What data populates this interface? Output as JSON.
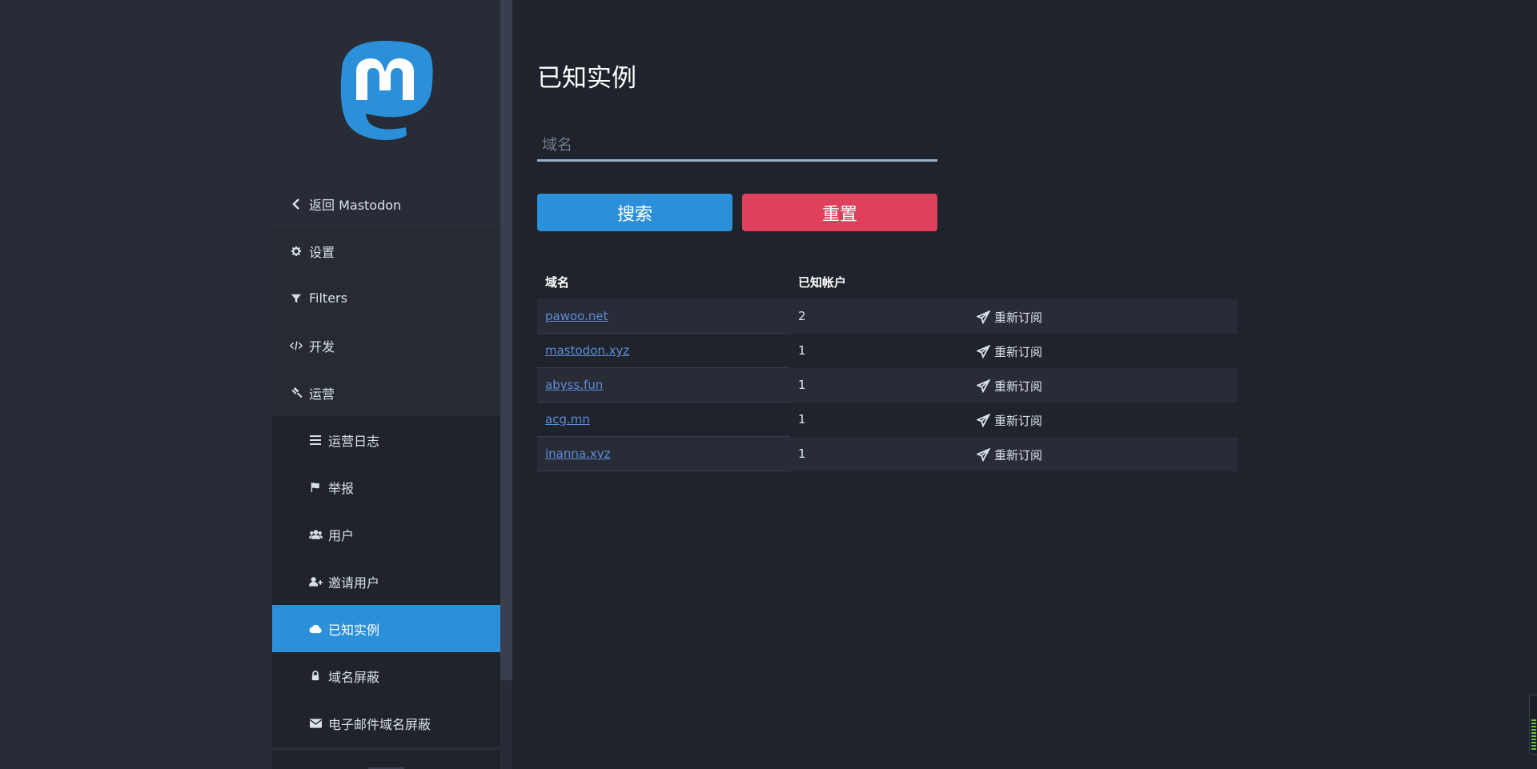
{
  "sidebar": {
    "back": "返回 Mastodon",
    "items": [
      {
        "label": "设置",
        "icon": "gear-icon"
      },
      {
        "label": "Filters",
        "icon": "filter-icon"
      },
      {
        "label": "开发",
        "icon": "code-icon"
      },
      {
        "label": "运营",
        "icon": "gavel-icon"
      }
    ],
    "sub_items": [
      {
        "label": "运营日志",
        "icon": "list-icon"
      },
      {
        "label": "举报",
        "icon": "flag-icon"
      },
      {
        "label": "用户",
        "icon": "users-icon"
      },
      {
        "label": "邀请用户",
        "icon": "user-plus-icon"
      },
      {
        "label": "已知实例",
        "icon": "cloud-icon",
        "active": true
      },
      {
        "label": "域名屏蔽",
        "icon": "lock-icon"
      },
      {
        "label": "电子邮件域名屏蔽",
        "icon": "envelope-icon"
      }
    ]
  },
  "main": {
    "title": "已知实例",
    "search": {
      "placeholder": "域名",
      "value": ""
    },
    "search_button": "搜索",
    "reset_button": "重置",
    "table": {
      "headers": [
        "域名",
        "已知帐户"
      ],
      "rows": [
        {
          "domain": "pawoo.net",
          "count": "2",
          "action": "重新订阅"
        },
        {
          "domain": "mastodon.xyz",
          "count": "1",
          "action": "重新订阅"
        },
        {
          "domain": "abyss.fun",
          "count": "1",
          "action": "重新订阅"
        },
        {
          "domain": "acg.mn",
          "count": "1",
          "action": "重新订阅"
        },
        {
          "domain": "inanna.xyz",
          "count": "1",
          "action": "重新订阅"
        }
      ]
    }
  },
  "colors": {
    "accent": "#2b90d9",
    "danger": "#df405a",
    "sidebar_bg": "#282c37",
    "content_bg": "#1f232b"
  }
}
